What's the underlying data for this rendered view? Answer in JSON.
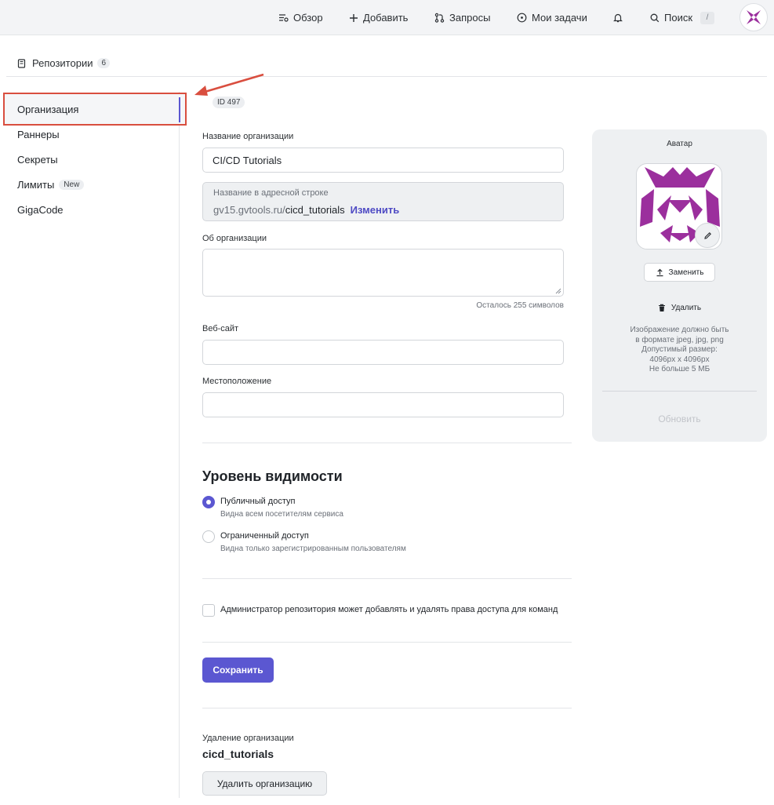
{
  "topnav": {
    "overview": "Обзор",
    "add": "Добавить",
    "requests": "Запросы",
    "my_tasks": "Мои задачи",
    "search": "Поиск",
    "search_shortcut": "/"
  },
  "repos": {
    "label": "Репозитории",
    "count": "6"
  },
  "sidebar": {
    "items": [
      {
        "label": "Организация",
        "active": true
      },
      {
        "label": "Раннеры"
      },
      {
        "label": "Секреты"
      },
      {
        "label": "Лимиты",
        "badge": "New"
      },
      {
        "label": "GigaCode"
      }
    ]
  },
  "form": {
    "id_badge": "ID 497",
    "name_label": "Название организации",
    "name_value": "CI/CD Tutorials",
    "url_label": "Название в адресной строке",
    "url_prefix": "gv15.gvtools.ru/",
    "url_slug": "cicd_tutorials",
    "url_change": "Изменить",
    "about_label": "Об организации",
    "about_hint": "Осталось 255 символов",
    "website_label": "Веб-сайт",
    "location_label": "Местоположение"
  },
  "visibility": {
    "title": "Уровень видимости",
    "options": [
      {
        "title": "Публичный доступ",
        "desc": "Видна всем посетителям сервиса",
        "selected": true
      },
      {
        "title": "Ограниченный доступ",
        "desc": "Видна только зарегистрированным пользователям",
        "selected": false
      }
    ]
  },
  "permissions": {
    "checkbox_label": "Администратор репозитория может добавлять и удалять права доступа для команд",
    "checked": false
  },
  "save_label": "Сохранить",
  "danger": {
    "label": "Удаление организации",
    "org_name": "cicd_tutorials",
    "button": "Удалить организацию"
  },
  "avatar": {
    "title": "Аватар",
    "replace": "Заменить",
    "delete": "Удалить",
    "info_lines": [
      "Изображение должно быть",
      "в формате jpeg, jpg, png",
      "Допустимый размер:",
      "4096px x 4096px",
      "Не больше 5 МБ"
    ],
    "update": "Обновить"
  },
  "colors": {
    "accent": "#5b57d1",
    "annotation_red": "#d94e3f",
    "avatar_purple": "#9b2f9d"
  }
}
